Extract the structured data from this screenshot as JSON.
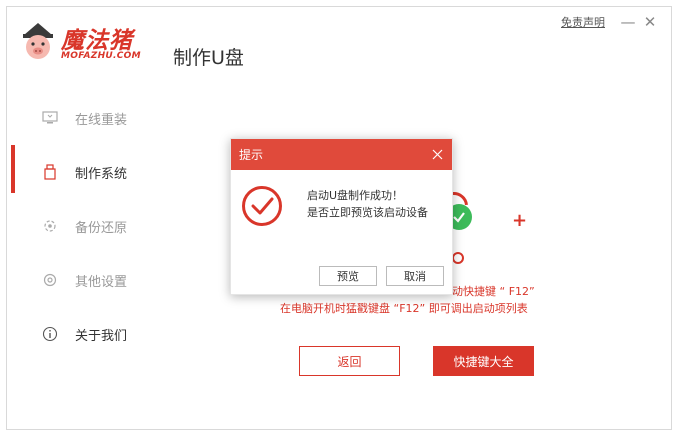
{
  "brand": {
    "name": "魔法猪",
    "url_text": "MOFAZHU.COM"
  },
  "app_title": "制作U盘",
  "titlebar": {
    "disclaimer": "免责声明",
    "minimize": "—",
    "close": "✕"
  },
  "sidebar": {
    "items": [
      {
        "label": "在线重装",
        "icon": "monitor-icon"
      },
      {
        "label": "制作系统",
        "icon": "usb-icon",
        "active": true
      },
      {
        "label": "备份还原",
        "icon": "backup-icon"
      },
      {
        "label": "其他设置",
        "icon": "gear-icon"
      },
      {
        "label": "关于我们",
        "icon": "info-icon"
      }
    ]
  },
  "main": {
    "hint_line1_partial": "动快捷键 “ F12”",
    "hint_line2": "在电脑开机时猛戳键盘 “F12” 即可调出启动项列表",
    "back_button": "返回",
    "hotkey_button": "快捷键大全"
  },
  "dialog": {
    "title": "提示",
    "message_line1": "启动U盘制作成功！",
    "message_line2": "是否立即预览该启动设备",
    "preview_button": "预览",
    "cancel_button": "取消"
  },
  "colors": {
    "accent": "#d9362a",
    "dialog_header": "#e04a3b",
    "success_green": "#3dbb5a"
  }
}
